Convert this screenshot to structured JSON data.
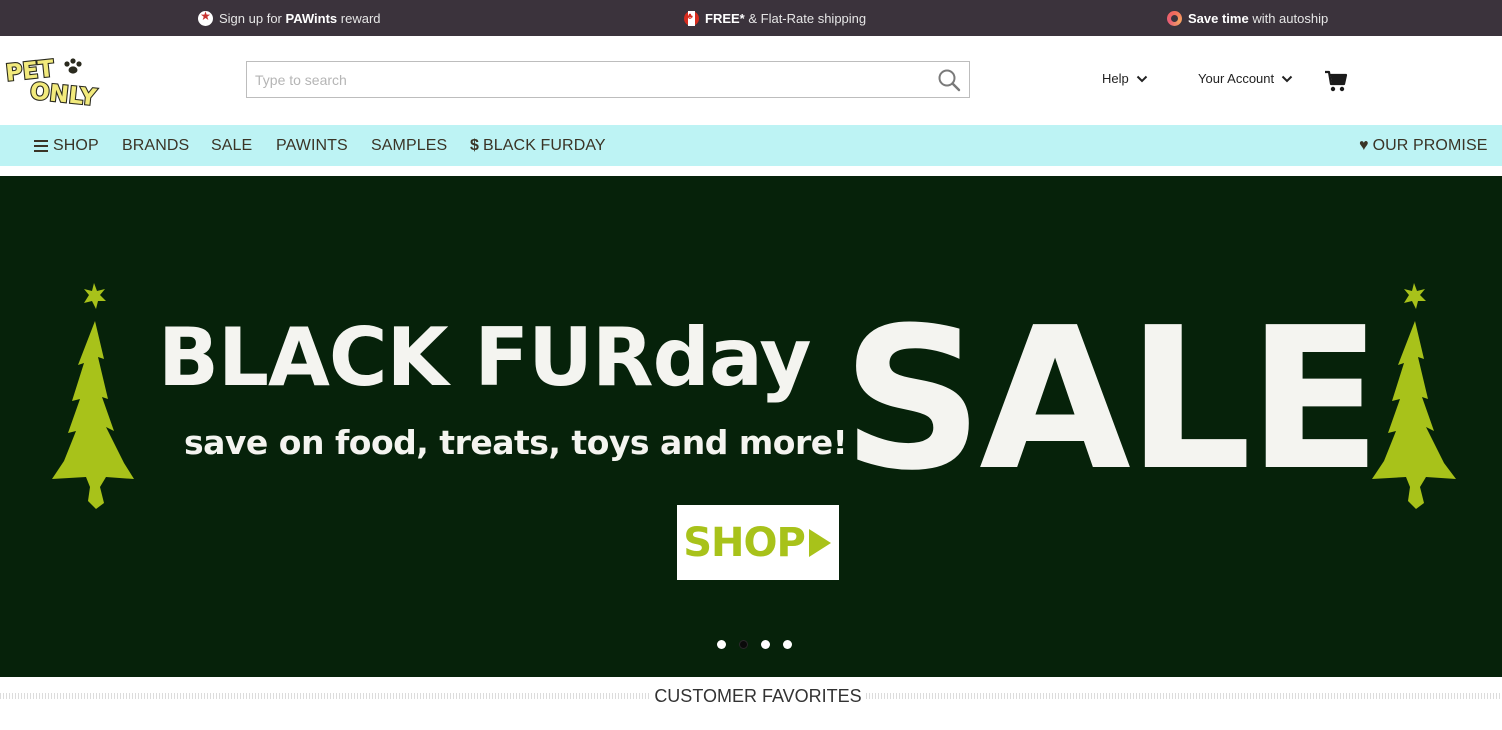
{
  "promo": {
    "item1": {
      "pre": "Sign up for ",
      "bold": "PAWints",
      "post": " reward",
      "icon": "star-badge-icon"
    },
    "item2": {
      "bold": "FREE*",
      "post": " & Flat-Rate shipping",
      "icon": "canada-flag-icon"
    },
    "item3": {
      "bold": "Save time",
      "post": " with autoship",
      "icon": "autoship-ring-icon"
    },
    "colors": {
      "background": "#3b333c"
    }
  },
  "header": {
    "logo_text": "PET ONLY",
    "search": {
      "placeholder": "Type to search",
      "value": ""
    },
    "help_label": "Help",
    "account_label": "Your Account"
  },
  "nav": {
    "items": [
      {
        "label": "SHOP",
        "icon": "menu-icon"
      },
      {
        "label": "BRANDS"
      },
      {
        "label": "SALE"
      },
      {
        "label": "PAWINTS"
      },
      {
        "label": "SAMPLES"
      },
      {
        "label": "BLACK FURDAY",
        "icon": "dollar-icon"
      }
    ],
    "promise_label": "OUR PROMISE",
    "promise_icon": "heart-icon",
    "colors": {
      "background": "#bdf3f4",
      "text": "#3a3426"
    }
  },
  "hero": {
    "title": "BLACK FURday",
    "subtitle": "save on food, treats, toys and more!",
    "sale": "SALE",
    "button_label": "SHOP",
    "active_slide": 2,
    "slide_count": 4,
    "colors": {
      "background": "#06220a",
      "tree": "#a8c21a",
      "text": "#f4f4f0"
    }
  },
  "section": {
    "title": "CUSTOMER FAVORITES"
  }
}
